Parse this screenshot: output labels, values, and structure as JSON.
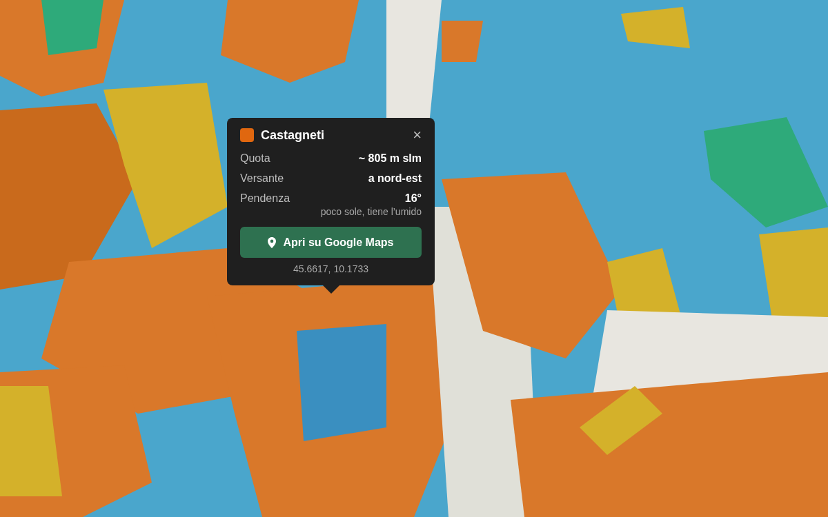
{
  "popup": {
    "title": "Castagneti",
    "color": "#e0670f",
    "close": "×",
    "rows": [
      {
        "label": "Quota",
        "value": "~ 805 m slm"
      },
      {
        "label": "Versante",
        "value": "a nord-est"
      },
      {
        "label": "Pendenza",
        "value": "16°"
      }
    ],
    "note": "poco sole, tiene l’umido",
    "button": "Apri su Google Maps",
    "coordinates": "45.6617, 10.1733"
  }
}
